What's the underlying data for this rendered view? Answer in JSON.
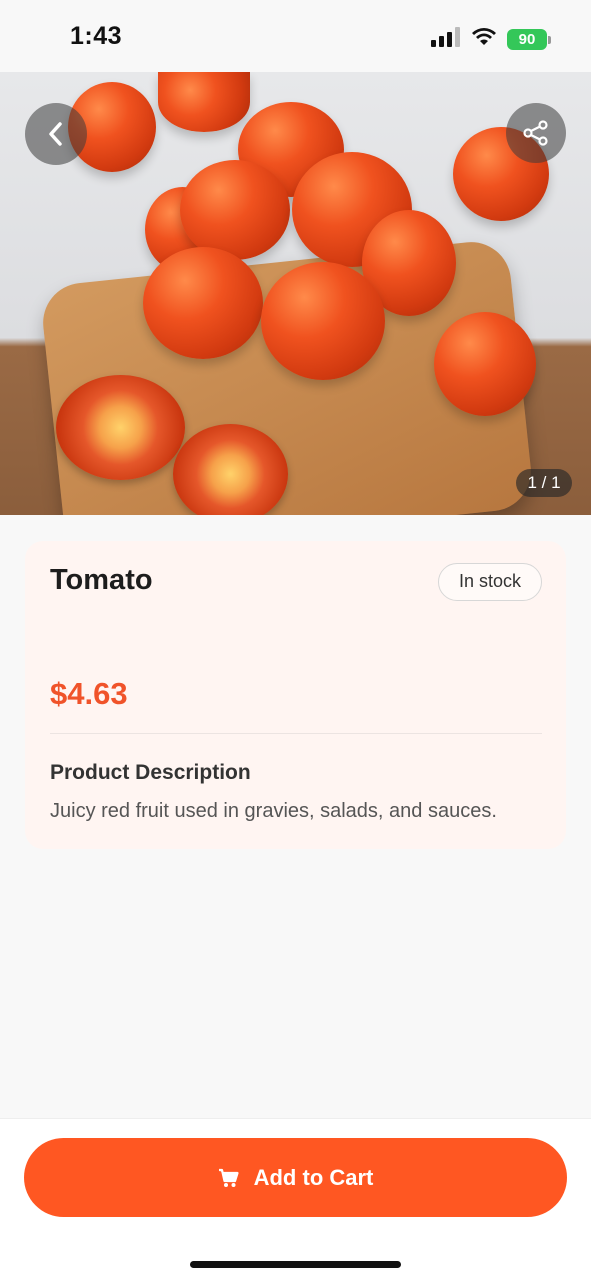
{
  "status_bar": {
    "time": "1:43",
    "battery": "90"
  },
  "gallery": {
    "counter": "1 / 1"
  },
  "product": {
    "name": "Tomato",
    "stock_status": "In stock",
    "price": "$4.63",
    "description_title": "Product Description",
    "description": "Juicy red fruit used in gravies, salads, and sauces."
  },
  "actions": {
    "add_to_cart_label": "Add to Cart"
  },
  "colors": {
    "accent": "#ff5722",
    "price": "#f0532a",
    "card_bg": "#fff5f2"
  }
}
